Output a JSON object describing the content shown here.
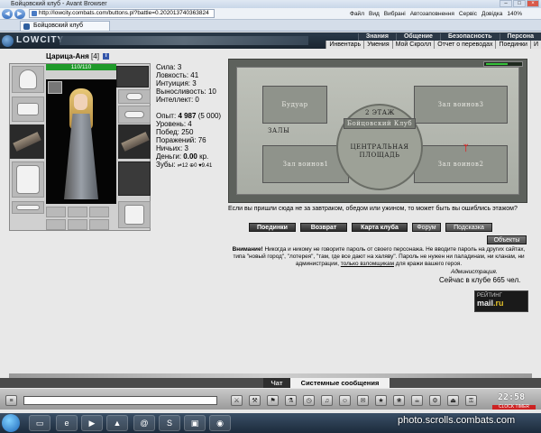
{
  "browser": {
    "window_title": "Бойцовский клуб - Avant Browser",
    "url": "http://lowcity.combats.com/buttons.pl?battle=0.202013740363824",
    "menu": [
      "Файл",
      "Вид",
      "Вибрані",
      "Автозаповнення",
      "Сервіс",
      "Довідка",
      "140%"
    ],
    "tab_title": "Бойцовский клуб"
  },
  "game": {
    "logo": "LOWCITY",
    "top_menu": [
      "Знания",
      "Общение",
      "Безопасность",
      "Персона"
    ],
    "sub_menu": [
      "Инвентарь",
      "Умения",
      "Мой Скролл",
      "Отчет о переводах",
      "Поединки",
      "И"
    ]
  },
  "character": {
    "name": "Царица-Аня",
    "level": "[4]",
    "info_icon_label": "i",
    "hp": "110/110",
    "stats": [
      {
        "label": "Сила",
        "value": "3"
      },
      {
        "label": "Ловкость",
        "value": "41"
      },
      {
        "label": "Интуиция",
        "value": "3"
      },
      {
        "label": "Выносливость",
        "value": "10"
      },
      {
        "label": "Интеллект",
        "value": "0"
      }
    ],
    "experience_label": "Опыт:",
    "experience": "4 987",
    "experience_next": "(5 000)",
    "details": [
      {
        "label": "Уровень",
        "value": "4"
      },
      {
        "label": "Побед",
        "value": "250"
      },
      {
        "label": "Поражений",
        "value": "76"
      },
      {
        "label": "Ничьих",
        "value": "3"
      }
    ],
    "money_label": "Деньги:",
    "money": "0.00",
    "money_unit": "кр.",
    "teeth_label": "Зубы:",
    "teeth": "⇌12 ⊕0 ♥9.41"
  },
  "map": {
    "rooms": {
      "boudoir": "Будуар",
      "hall3": "Зал воинов3",
      "floor2": "2 ЭТАЖ",
      "fight_club": "Бойцовский Клуб",
      "halls": "ЗАЛЫ",
      "central": "ЦЕНТРАЛЬНАЯ ПЛОЩАДЬ",
      "hall1": "Зал воинов1",
      "hall2": "Зал воинов2"
    },
    "marker": "ᛉ"
  },
  "hint": "Если вы пришли сюда не за завтраком, обедом или ужином, то может быть вы ошиблись этажом?",
  "actions": {
    "fights": "Поединки",
    "back": "Возврат",
    "club_map": "Карта клуба",
    "forum": "Форум",
    "hint_btn": "Подсказка",
    "objects": "Объекты"
  },
  "warning": {
    "attention": "Внимание!",
    "text1": " Никогда и никому не говорите пароль от своего персонажа. Не вводите пароль на других сайтах, типа \"новый город\", \"лотерея\", \"там, где все дают на халяву\". Пароль не нужен ни паладинам, ни кланам, ни администрации, ",
    "link": "только взломщикам",
    "text2": " для кражи вашего героя.",
    "sign": "Администрация.",
    "online": "Сейчас в клубе 665 чел."
  },
  "rating_widget": {
    "label": "РЕЙТИНГ",
    "brand": "mail",
    "brand_suffix": ".ru"
  },
  "chat": {
    "tab_chat": "Чат",
    "tab_system": "Системные сообщения",
    "input_value": ""
  },
  "clock": {
    "time": "22:58",
    "label": "CLOCK TIMER"
  },
  "watermark": "photo.scrolls.combats.com",
  "colors": {
    "hp": "#1f9a2a",
    "header": "#2a3a4a",
    "accent_gold": "#e3c12a"
  }
}
